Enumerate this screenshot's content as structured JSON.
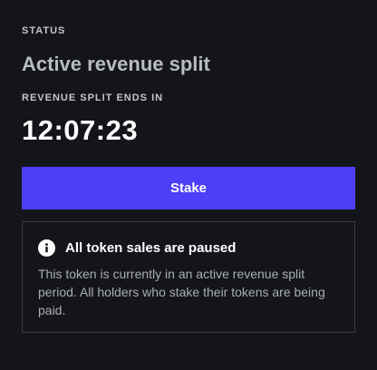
{
  "status": {
    "label": "STATUS",
    "value": "Active revenue split"
  },
  "split": {
    "label": "REVENUE SPLIT ENDS IN",
    "countdown": "12:07:23"
  },
  "actions": {
    "stake_label": "Stake"
  },
  "notice": {
    "icon": "info-icon",
    "title": "All token sales are paused",
    "body": "This token is currently in an active revenue split period. All holders who stake their tokens are being paid."
  },
  "colors": {
    "background": "#14151a",
    "accent": "#4d3ef7",
    "border": "#3a3c43"
  }
}
